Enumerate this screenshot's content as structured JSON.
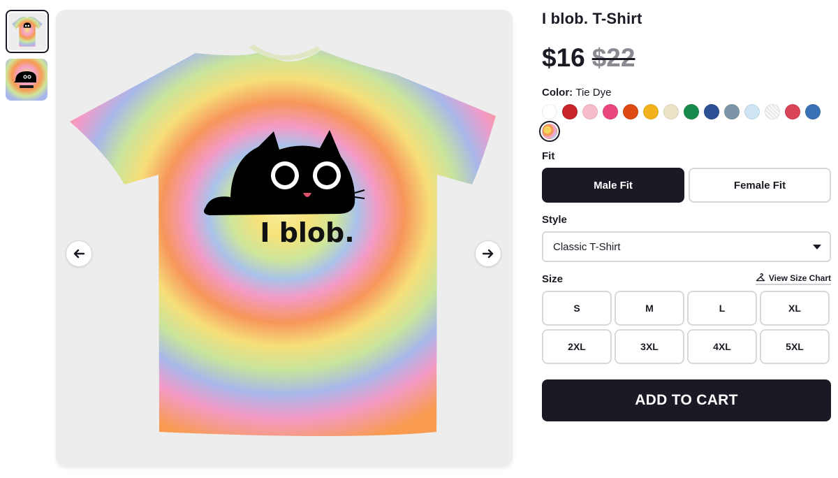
{
  "product": {
    "title": "I blob. T-Shirt",
    "price": "$16",
    "original_price": "$22",
    "print_text": "I blob."
  },
  "color": {
    "label": "Color:",
    "selected": "Tie Dye",
    "swatches": [
      "#ffffff",
      "#c8242b",
      "#f7bcc9",
      "#e8487f",
      "#dd4a14",
      "#f2b21e",
      "#ece2c8",
      "#17894a",
      "#2d4f93",
      "#7d95a6",
      "#cfe4f2",
      "white-heather",
      "#d94458",
      "#3872b5",
      "tie-dye"
    ]
  },
  "fit": {
    "label": "Fit",
    "options": [
      "Male Fit",
      "Female Fit"
    ],
    "selected": "Male Fit"
  },
  "style": {
    "label": "Style",
    "selected": "Classic T-Shirt"
  },
  "size": {
    "label": "Size",
    "chart_link": "View Size Chart",
    "options": [
      "S",
      "M",
      "L",
      "XL",
      "2XL",
      "3XL",
      "4XL",
      "5XL"
    ]
  },
  "cart": {
    "label": "ADD TO CART"
  },
  "icons": {
    "prev": "arrow-left-icon",
    "next": "arrow-right-icon",
    "size_chart": "hanger-icon",
    "dropdown": "caret-down-icon"
  }
}
